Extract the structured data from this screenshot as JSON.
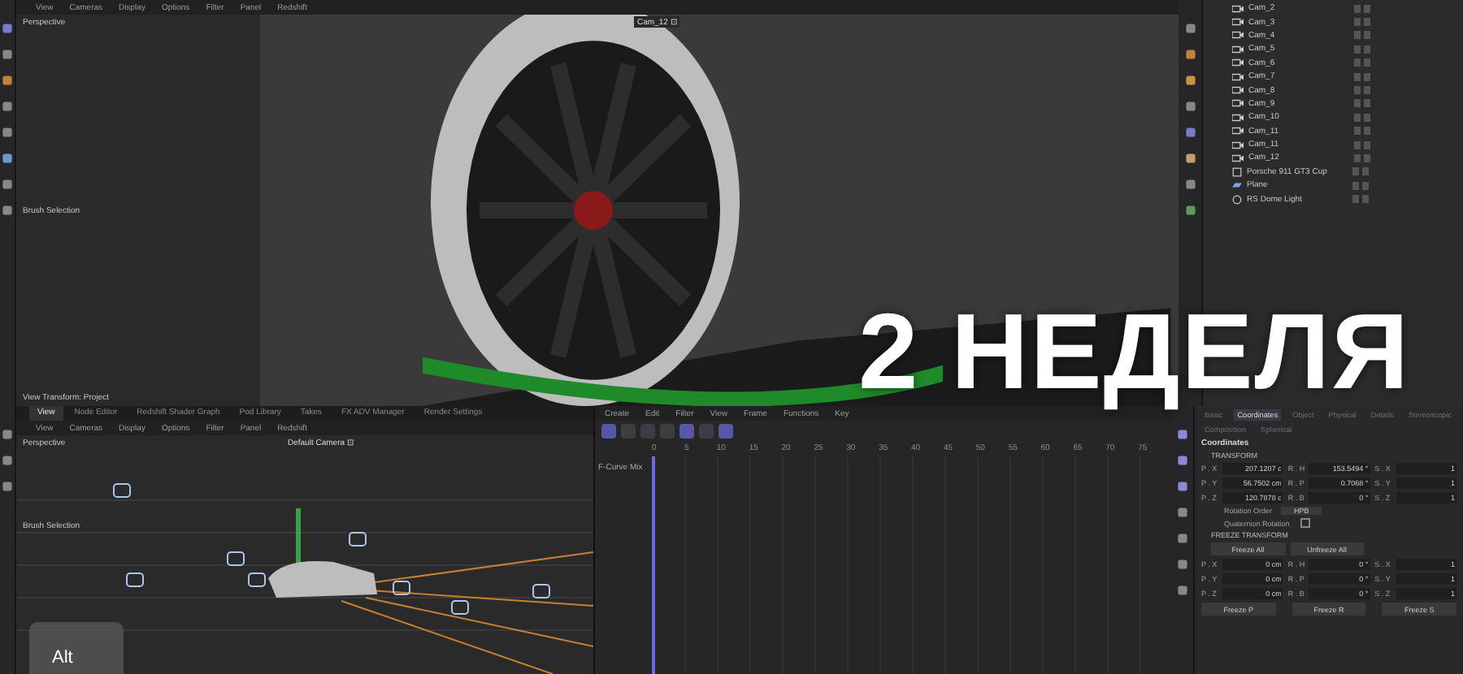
{
  "top_viewport": {
    "menu": [
      "View",
      "Cameras",
      "Display",
      "Options",
      "Filter",
      "Panel",
      "Redshift"
    ],
    "label": "Perspective",
    "camera": "Cam_12 ⊡",
    "brush_label": "Brush Selection",
    "footer": "View Transform: Project"
  },
  "objects": [
    {
      "name": "Cam_2",
      "kind": "camera"
    },
    {
      "name": "Cam_3",
      "kind": "camera"
    },
    {
      "name": "Cam_4",
      "kind": "camera"
    },
    {
      "name": "Cam_5",
      "kind": "camera"
    },
    {
      "name": "Cam_6",
      "kind": "camera"
    },
    {
      "name": "Cam_7",
      "kind": "camera"
    },
    {
      "name": "Cam_8",
      "kind": "camera"
    },
    {
      "name": "Cam_9",
      "kind": "camera"
    },
    {
      "name": "Cam_10",
      "kind": "camera"
    },
    {
      "name": "Cam_11",
      "kind": "camera"
    },
    {
      "name": "Cam_11",
      "kind": "camera"
    },
    {
      "name": "Cam_12",
      "kind": "camera"
    },
    {
      "name": "Porsche 911 GT3 Cup",
      "kind": "model"
    },
    {
      "name": "Plane",
      "kind": "plane"
    },
    {
      "name": "RS Dome Light",
      "kind": "light"
    }
  ],
  "overlay_title": "2 НЕДЕЛЯ",
  "bottom_tabs": [
    {
      "label": "View",
      "selected": true
    },
    {
      "label": "Node Editor",
      "selected": false
    },
    {
      "label": "Redshift Shader Graph",
      "selected": false
    },
    {
      "label": "Pod Library",
      "selected": false
    },
    {
      "label": "Takes",
      "selected": false
    },
    {
      "label": "FX ADV Manager",
      "selected": false
    },
    {
      "label": "Render Settings",
      "selected": false
    }
  ],
  "bottom_viewport": {
    "menu": [
      "View",
      "Cameras",
      "Display",
      "Options",
      "Filter",
      "Panel",
      "Redshift"
    ],
    "label": "Perspective",
    "camera": "Default Camera ⊡",
    "brush_label": "Brush Selection"
  },
  "timeline": {
    "menu": [
      "Create",
      "Edit",
      "Filter",
      "View",
      "Frame",
      "Functions",
      "Key"
    ],
    "track_label": "F-Curve Mix",
    "ticks": [
      "0",
      "5",
      "10",
      "15",
      "20",
      "25",
      "30",
      "35",
      "40",
      "45",
      "50",
      "55",
      "60",
      "65",
      "70",
      "75"
    ]
  },
  "attributes": {
    "tabs": [
      {
        "label": "Basic",
        "selected": false
      },
      {
        "label": "Coordinates",
        "selected": true
      },
      {
        "label": "Object",
        "selected": false
      },
      {
        "label": "Physical",
        "selected": false
      },
      {
        "label": "Details",
        "selected": false
      },
      {
        "label": "Stereoscopic",
        "selected": false
      },
      {
        "label": "Composition",
        "selected": false
      },
      {
        "label": "Spherical",
        "selected": false
      }
    ],
    "section": "Coordinates",
    "transform_heading": "TRANSFORM",
    "rows": [
      [
        {
          "label": "P . X",
          "value": "207.1207 c"
        },
        {
          "label": "R . H",
          "value": "153.5494 °"
        },
        {
          "label": "S . X",
          "value": "1"
        }
      ],
      [
        {
          "label": "P . Y",
          "value": "56.7502 cm"
        },
        {
          "label": "R . P",
          "value": "0.7068 °"
        },
        {
          "label": "S . Y",
          "value": "1"
        }
      ],
      [
        {
          "label": "P . Z",
          "value": "120.7878 c"
        },
        {
          "label": "R . B",
          "value": "0 °"
        },
        {
          "label": "S . Z",
          "value": "1"
        }
      ]
    ],
    "rotation_order_label": "Rotation Order",
    "rotation_order_value": "HPB",
    "quaternion_label": "Quaternion Rotation",
    "quaternion_checked": false,
    "freeze_heading": "FREEZE TRANSFORM",
    "freeze_buttons": [
      "Freeze All",
      "Unfreeze All"
    ],
    "freeze_rows": [
      [
        {
          "label": "P . X",
          "value": "0 cm"
        },
        {
          "label": "R . H",
          "value": "0 °"
        },
        {
          "label": "S . X",
          "value": "1"
        }
      ],
      [
        {
          "label": "P . Y",
          "value": "0 cm"
        },
        {
          "label": "R . P",
          "value": "0 °"
        },
        {
          "label": "S . Y",
          "value": "1"
        }
      ],
      [
        {
          "label": "P . Z",
          "value": "0 cm"
        },
        {
          "label": "R . B",
          "value": "0 °"
        },
        {
          "label": "S . Z",
          "value": "1"
        }
      ]
    ],
    "freeze_axis_buttons": [
      "Freeze P",
      "Freeze R",
      "Freeze S"
    ]
  },
  "key_overlay": "Alt"
}
